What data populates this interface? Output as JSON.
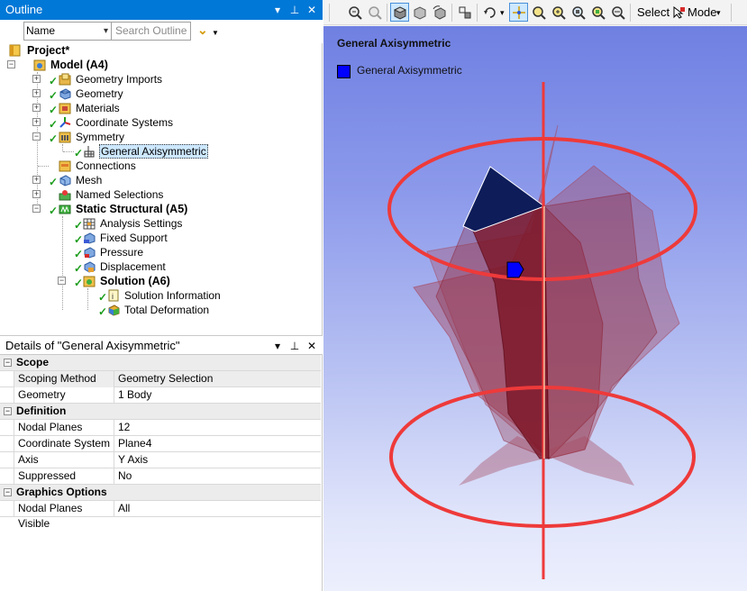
{
  "outline": {
    "title": "Outline",
    "filter_field": "Name",
    "search_placeholder": "Search Outline",
    "tree": [
      {
        "label": "Project*",
        "bold": true
      },
      {
        "label": "Model (A4)",
        "bold": true
      },
      {
        "label": "Geometry Imports"
      },
      {
        "label": "Geometry"
      },
      {
        "label": "Materials"
      },
      {
        "label": "Coordinate Systems"
      },
      {
        "label": "Symmetry"
      },
      {
        "label": "General Axisymmetric",
        "selected": true
      },
      {
        "label": "Connections"
      },
      {
        "label": "Mesh"
      },
      {
        "label": "Named Selections"
      },
      {
        "label": "Static Structural (A5)",
        "bold": true
      },
      {
        "label": "Analysis Settings"
      },
      {
        "label": "Fixed Support"
      },
      {
        "label": "Pressure"
      },
      {
        "label": "Displacement"
      },
      {
        "label": "Solution (A6)",
        "bold": true
      },
      {
        "label": "Solution Information"
      },
      {
        "label": "Total Deformation"
      }
    ]
  },
  "details": {
    "title": "Details of \"General Axisymmetric\"",
    "groups": [
      {
        "name": "Scope",
        "rows": [
          {
            "label": "Scoping Method",
            "value": "Geometry Selection",
            "highlight": true
          },
          {
            "label": "Geometry",
            "value": "1 Body"
          }
        ]
      },
      {
        "name": "Definition",
        "rows": [
          {
            "label": "Nodal Planes",
            "value": "12"
          },
          {
            "label": "Coordinate System",
            "value": "Plane4"
          },
          {
            "label": "Axis",
            "value": "Y Axis"
          },
          {
            "label": "Suppressed",
            "value": "No"
          }
        ]
      },
      {
        "name": "Graphics Options",
        "rows": [
          {
            "label": "Nodal Planes Visible",
            "value": "All"
          }
        ]
      }
    ]
  },
  "toolbar": {
    "select_label": "Select",
    "mode_label": "Mode"
  },
  "viewport": {
    "title": "General Axisymmetric",
    "legend_label": "General Axisymmetric",
    "legend_color": "#0000ff",
    "ring_color": "#ee3a3a",
    "sector_color": "#8b1a2a"
  },
  "icons": {
    "pane_controls": [
      "dropdown-icon",
      "pin-icon",
      "close-icon"
    ],
    "toolbar": [
      "zoom-in-icon",
      "zoom-out-icon",
      "isometric-view-icon",
      "box-view-icon",
      "rotate-view-icon",
      "previous-view-icon",
      "rotate-icon",
      "pan-icon",
      "zoom-box-icon",
      "zoom-icon",
      "zoom-fit-icon",
      "zoom-all-icon",
      "zoom-to-fit-icon"
    ]
  }
}
